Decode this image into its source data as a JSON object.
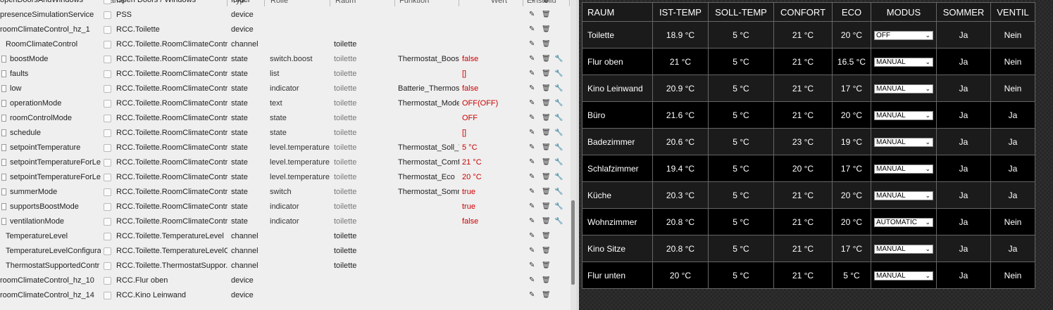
{
  "left": {
    "headers": [
      {
        "label": "Name"
      },
      {
        "label": "Typ"
      },
      {
        "label": "Rolle"
      },
      {
        "label": "Raum"
      },
      {
        "label": "Funktion"
      },
      {
        "label": "Wert"
      },
      {
        "label": "Einstellu"
      }
    ],
    "rows": [
      {
        "name": "openDoorsAndWindows",
        "id": "Open Doors / Windows",
        "typ": "folder",
        "role": "",
        "room": "",
        "func": "",
        "val": "",
        "tool": false
      },
      {
        "name": "presenceSimulationService",
        "id": "PSS",
        "typ": "device",
        "role": "",
        "room": "",
        "func": "",
        "val": "",
        "tool": false
      },
      {
        "name": "roomClimateControl_hz_1",
        "id": "RCC.Toilette",
        "typ": "device",
        "role": "",
        "room": "",
        "func": "",
        "val": "",
        "tool": false
      },
      {
        "name": "RoomClimateControl",
        "id": "RCC.Toilette.RoomClimateContr...",
        "typ": "channel",
        "role": "",
        "room": "toilette",
        "func": "",
        "val": "",
        "tool": false
      },
      {
        "name": "boostMode",
        "id": "RCC.Toilette.RoomClimateContr...",
        "typ": "state",
        "role": "switch.boost",
        "room": "toilette",
        "func": "Thermostat_Boost",
        "val": "false",
        "tool": true
      },
      {
        "name": "faults",
        "id": "RCC.Toilette.RoomClimateContr...",
        "typ": "state",
        "role": "list",
        "room": "toilette",
        "func": "",
        "val": "[]",
        "tool": true
      },
      {
        "name": "low",
        "id": "RCC.Toilette.RoomClimateContr...",
        "typ": "state",
        "role": "indicator",
        "room": "toilette",
        "func": "Batterie_Thermost",
        "val": "false",
        "tool": true
      },
      {
        "name": "operationMode",
        "id": "RCC.Toilette.RoomClimateContr...",
        "typ": "state",
        "role": "text",
        "room": "toilette",
        "func": "Thermostat_Mode",
        "val": "OFF(OFF)",
        "tool": true
      },
      {
        "name": "roomControlMode",
        "id": "RCC.Toilette.RoomClimateContr...",
        "typ": "state",
        "role": "state",
        "room": "toilette",
        "func": "",
        "val": "OFF",
        "tool": true
      },
      {
        "name": "schedule",
        "id": "RCC.Toilette.RoomClimateContr...",
        "typ": "state",
        "role": "state",
        "room": "toilette",
        "func": "",
        "val": "[]",
        "tool": true
      },
      {
        "name": "setpointTemperature",
        "id": "RCC.Toilette.RoomClimateContr...",
        "typ": "state",
        "role": "level.temperature",
        "room": "toilette",
        "func": "Thermostat_Soll_T",
        "val": "5 °C",
        "tool": true
      },
      {
        "name": "setpointTemperatureForLe",
        "id": "RCC.Toilette.RoomClimateContr...",
        "typ": "state",
        "role": "level.temperature",
        "room": "toilette",
        "func": "Thermostat_Comf",
        "val": "21 °C",
        "tool": true
      },
      {
        "name": "setpointTemperatureForLe",
        "id": "RCC.Toilette.RoomClimateContr...",
        "typ": "state",
        "role": "level.temperature",
        "room": "toilette",
        "func": "Thermostat_Eco",
        "val": "20 °C",
        "tool": true
      },
      {
        "name": "summerMode",
        "id": "RCC.Toilette.RoomClimateContr...",
        "typ": "state",
        "role": "switch",
        "room": "toilette",
        "func": "Thermostat_Somn",
        "val": "true",
        "tool": true
      },
      {
        "name": "supportsBoostMode",
        "id": "RCC.Toilette.RoomClimateContr...",
        "typ": "state",
        "role": "indicator",
        "room": "toilette",
        "func": "",
        "val": "true",
        "tool": true
      },
      {
        "name": "ventilationMode",
        "id": "RCC.Toilette.RoomClimateContr...",
        "typ": "state",
        "role": "indicator",
        "room": "toilette",
        "func": "",
        "val": "false",
        "tool": true
      },
      {
        "name": "TemperatureLevel",
        "id": "RCC.Toilette.TemperatureLevel",
        "typ": "channel",
        "role": "",
        "room": "toilette",
        "func": "",
        "val": "",
        "tool": false
      },
      {
        "name": "TemperatureLevelConfigurat",
        "id": "RCC.Toilette.TemperatureLevelC...",
        "typ": "channel",
        "role": "",
        "room": "toilette",
        "func": "",
        "val": "",
        "tool": false
      },
      {
        "name": "ThermostatSupportedContr",
        "id": "RCC.Toilette.ThermostatSuppor...",
        "typ": "channel",
        "role": "",
        "room": "toilette",
        "func": "",
        "val": "",
        "tool": false
      },
      {
        "name": "roomClimateControl_hz_10",
        "id": "RCC.Flur oben",
        "typ": "device",
        "role": "",
        "room": "",
        "func": "",
        "val": "",
        "tool": false
      },
      {
        "name": "roomClimateControl_hz_14",
        "id": "RCC.Kino Leinwand",
        "typ": "device",
        "role": "",
        "room": "",
        "func": "",
        "val": "",
        "tool": false
      }
    ]
  },
  "right": {
    "headers": [
      "RAUM",
      "IST-TEMP",
      "SOLL-TEMP",
      "CONFORT",
      "ECO",
      "MODUS",
      "SOMMER",
      "VENTIL"
    ],
    "rows": [
      {
        "room": "Toilette",
        "ist": "18.9 °C",
        "soll": "5 °C",
        "confort": "21 °C",
        "eco": "20 °C",
        "mode": "OFF",
        "sommer": "Ja",
        "ventil": "Nein"
      },
      {
        "room": "Flur oben",
        "ist": "21 °C",
        "soll": "5 °C",
        "confort": "21 °C",
        "eco": "16.5 °C",
        "mode": "MANUAL",
        "sommer": "Ja",
        "ventil": "Nein"
      },
      {
        "room": "Kino Leinwand",
        "ist": "20.9 °C",
        "soll": "5 °C",
        "confort": "21 °C",
        "eco": "17 °C",
        "mode": "MANUAL",
        "sommer": "Ja",
        "ventil": "Nein"
      },
      {
        "room": "Büro",
        "ist": "21.6 °C",
        "soll": "5 °C",
        "confort": "21 °C",
        "eco": "20 °C",
        "mode": "MANUAL",
        "sommer": "Ja",
        "ventil": "Ja"
      },
      {
        "room": "Badezimmer",
        "ist": "20.6 °C",
        "soll": "5 °C",
        "confort": "23 °C",
        "eco": "19 °C",
        "mode": "MANUAL",
        "sommer": "Ja",
        "ventil": "Ja"
      },
      {
        "room": "Schlafzimmer",
        "ist": "19.4 °C",
        "soll": "5 °C",
        "confort": "20 °C",
        "eco": "17 °C",
        "mode": "MANUAL",
        "sommer": "Ja",
        "ventil": "Ja"
      },
      {
        "room": "Küche",
        "ist": "20.3 °C",
        "soll": "5 °C",
        "confort": "21 °C",
        "eco": "20 °C",
        "mode": "MANUAL",
        "sommer": "Ja",
        "ventil": "Ja"
      },
      {
        "room": "Wohnzimmer",
        "ist": "20.8 °C",
        "soll": "5 °C",
        "confort": "21 °C",
        "eco": "20 °C",
        "mode": "AUTOMATIC",
        "sommer": "Ja",
        "ventil": "Nein"
      },
      {
        "room": "Kino Sitze",
        "ist": "20.8 °C",
        "soll": "5 °C",
        "confort": "21 °C",
        "eco": "17 °C",
        "mode": "MANUAL",
        "sommer": "Ja",
        "ventil": "Ja"
      },
      {
        "room": "Flur unten",
        "ist": "20 °C",
        "soll": "5 °C",
        "confort": "21 °C",
        "eco": "5 °C",
        "mode": "MANUAL",
        "sommer": "Ja",
        "ventil": "Nein"
      }
    ]
  }
}
